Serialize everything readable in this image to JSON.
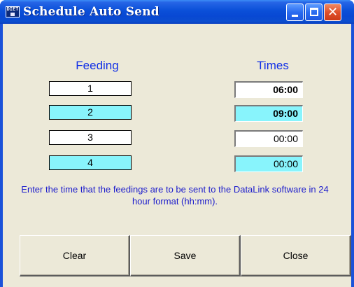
{
  "window": {
    "title": "Schedule Auto Send",
    "icon_label": "DIET",
    "controls": [
      "minimize-icon",
      "maximize-icon",
      "close-icon"
    ],
    "close_glyph": "✕"
  },
  "headers": {
    "feeding": "Feeding",
    "times": "Times"
  },
  "rows": [
    {
      "feeding": "1",
      "time": "06:00",
      "highlight": false,
      "time_bold": true
    },
    {
      "feeding": "2",
      "time": "09:00",
      "highlight": true,
      "time_bold": true
    },
    {
      "feeding": "3",
      "time": "00:00",
      "highlight": false,
      "time_bold": false
    },
    {
      "feeding": "4",
      "time": "00:00",
      "highlight": true,
      "time_bold": false
    }
  ],
  "instructions": "Enter the time that the feedings are to be sent to the DataLink software in 24 hour format (hh:mm).",
  "buttons": {
    "clear": "Clear",
    "save": "Save",
    "close": "Close"
  },
  "colors": {
    "title_bar": "#0a4fd8",
    "dialog_bg": "#ece9d8",
    "highlight_cyan": "#88f4fc",
    "header_blue": "#1230e6",
    "instruction_blue": "#1c1ccc"
  }
}
